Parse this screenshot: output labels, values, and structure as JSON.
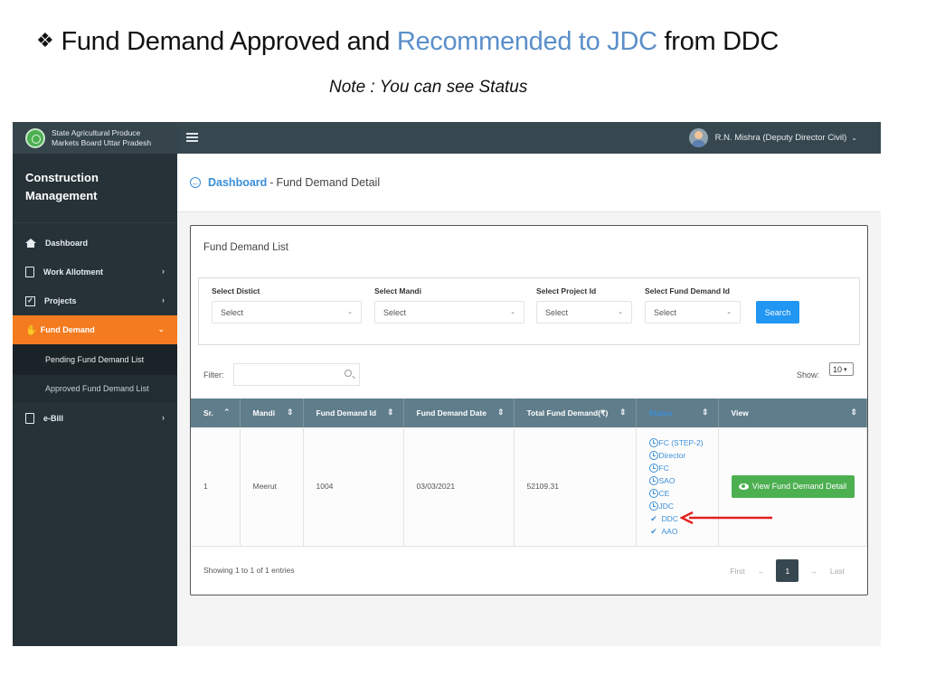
{
  "slide": {
    "title_part1": "Fund Demand Approved  and ",
    "title_highlight": "Recommended to JDC",
    "title_part2": " from DDC",
    "bullet_icon": "diamond-bullet-icon",
    "note": "Note : You can see Status",
    "highlight_color": "#5b8fc9"
  },
  "app": {
    "brand_line1": "State Agricultural Produce",
    "brand_line2": "Markets Board Uttar Pradesh",
    "user_name": "R.N. Mishra (Deputy Director Civil)",
    "accent_color": "#f47b20",
    "primary_color": "#2196f3",
    "success_color": "#4caf50"
  },
  "sidebar": {
    "title": "Construction Management",
    "items": [
      {
        "label": "Dashboard",
        "icon": "home-icon"
      },
      {
        "label": "Work Allotment",
        "icon": "document-icon"
      },
      {
        "label": "Projects",
        "icon": "checkbox-icon"
      },
      {
        "label": "Fund Demand",
        "icon": "hand-coin-icon"
      },
      {
        "label": "e-Bill",
        "icon": "clipboard-icon"
      }
    ],
    "sub_items": [
      {
        "label": "Pending Fund Demand List"
      },
      {
        "label": "Approved Fund Demand List"
      }
    ]
  },
  "breadcrumb": {
    "link": "Dashboard",
    "separator": "-",
    "current": "Fund Demand Detail"
  },
  "card": {
    "title": "Fund Demand List",
    "filters": [
      {
        "label": "Select Distict",
        "value": "Select"
      },
      {
        "label": "Select Mandi",
        "value": "Select"
      },
      {
        "label": "Select Project Id",
        "value": "Select"
      },
      {
        "label": "Select Fund Demand Id",
        "value": "Select"
      }
    ],
    "search_button": "Search",
    "filter_label": "Filter:",
    "filter_value": "",
    "show_label": "Show:",
    "show_value": "10"
  },
  "table": {
    "columns": [
      "Sr.",
      "Mandi",
      "Fund Demand Id",
      "Fund Demand Date",
      "Total Fund Demand(₹)",
      "Status",
      "View"
    ],
    "rows": [
      {
        "sr": "1",
        "mandi": "Meerut",
        "fund_demand_id": "1004",
        "date": "03/03/2021",
        "total": "52109.31",
        "status": [
          {
            "label": "FC (STEP-2)",
            "state": "pending"
          },
          {
            "label": "Director",
            "state": "pending"
          },
          {
            "label": "FC",
            "state": "pending"
          },
          {
            "label": "SAO",
            "state": "pending"
          },
          {
            "label": "CE",
            "state": "pending"
          },
          {
            "label": "JDC",
            "state": "pending"
          },
          {
            "label": "DDC",
            "state": "approved"
          },
          {
            "label": "AAO",
            "state": "approved"
          }
        ],
        "view_button": "View Fund Demand Detail"
      }
    ]
  },
  "footer": {
    "entries": "Showing 1 to 1 of 1 entries",
    "first": "First",
    "prev": "←",
    "current_page": "1",
    "next": "→",
    "last": "Last"
  }
}
